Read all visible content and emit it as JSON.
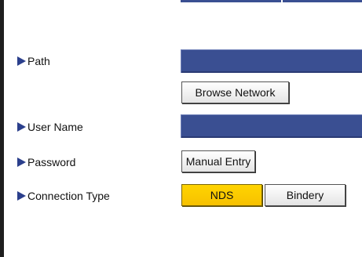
{
  "form": {
    "path": {
      "label": "Path",
      "browse_button": "Browse Network"
    },
    "user_name": {
      "label": "User Name"
    },
    "password": {
      "label": "Password",
      "manual_entry_button": "Manual Entry"
    },
    "connection_type": {
      "label": "Connection Type",
      "options": [
        "NDS",
        "Bindery"
      ],
      "selected": "NDS"
    }
  },
  "colors": {
    "field_fill": "#3a4f92",
    "selected_option": "#ffd400",
    "arrow": "#2b3f8c"
  }
}
